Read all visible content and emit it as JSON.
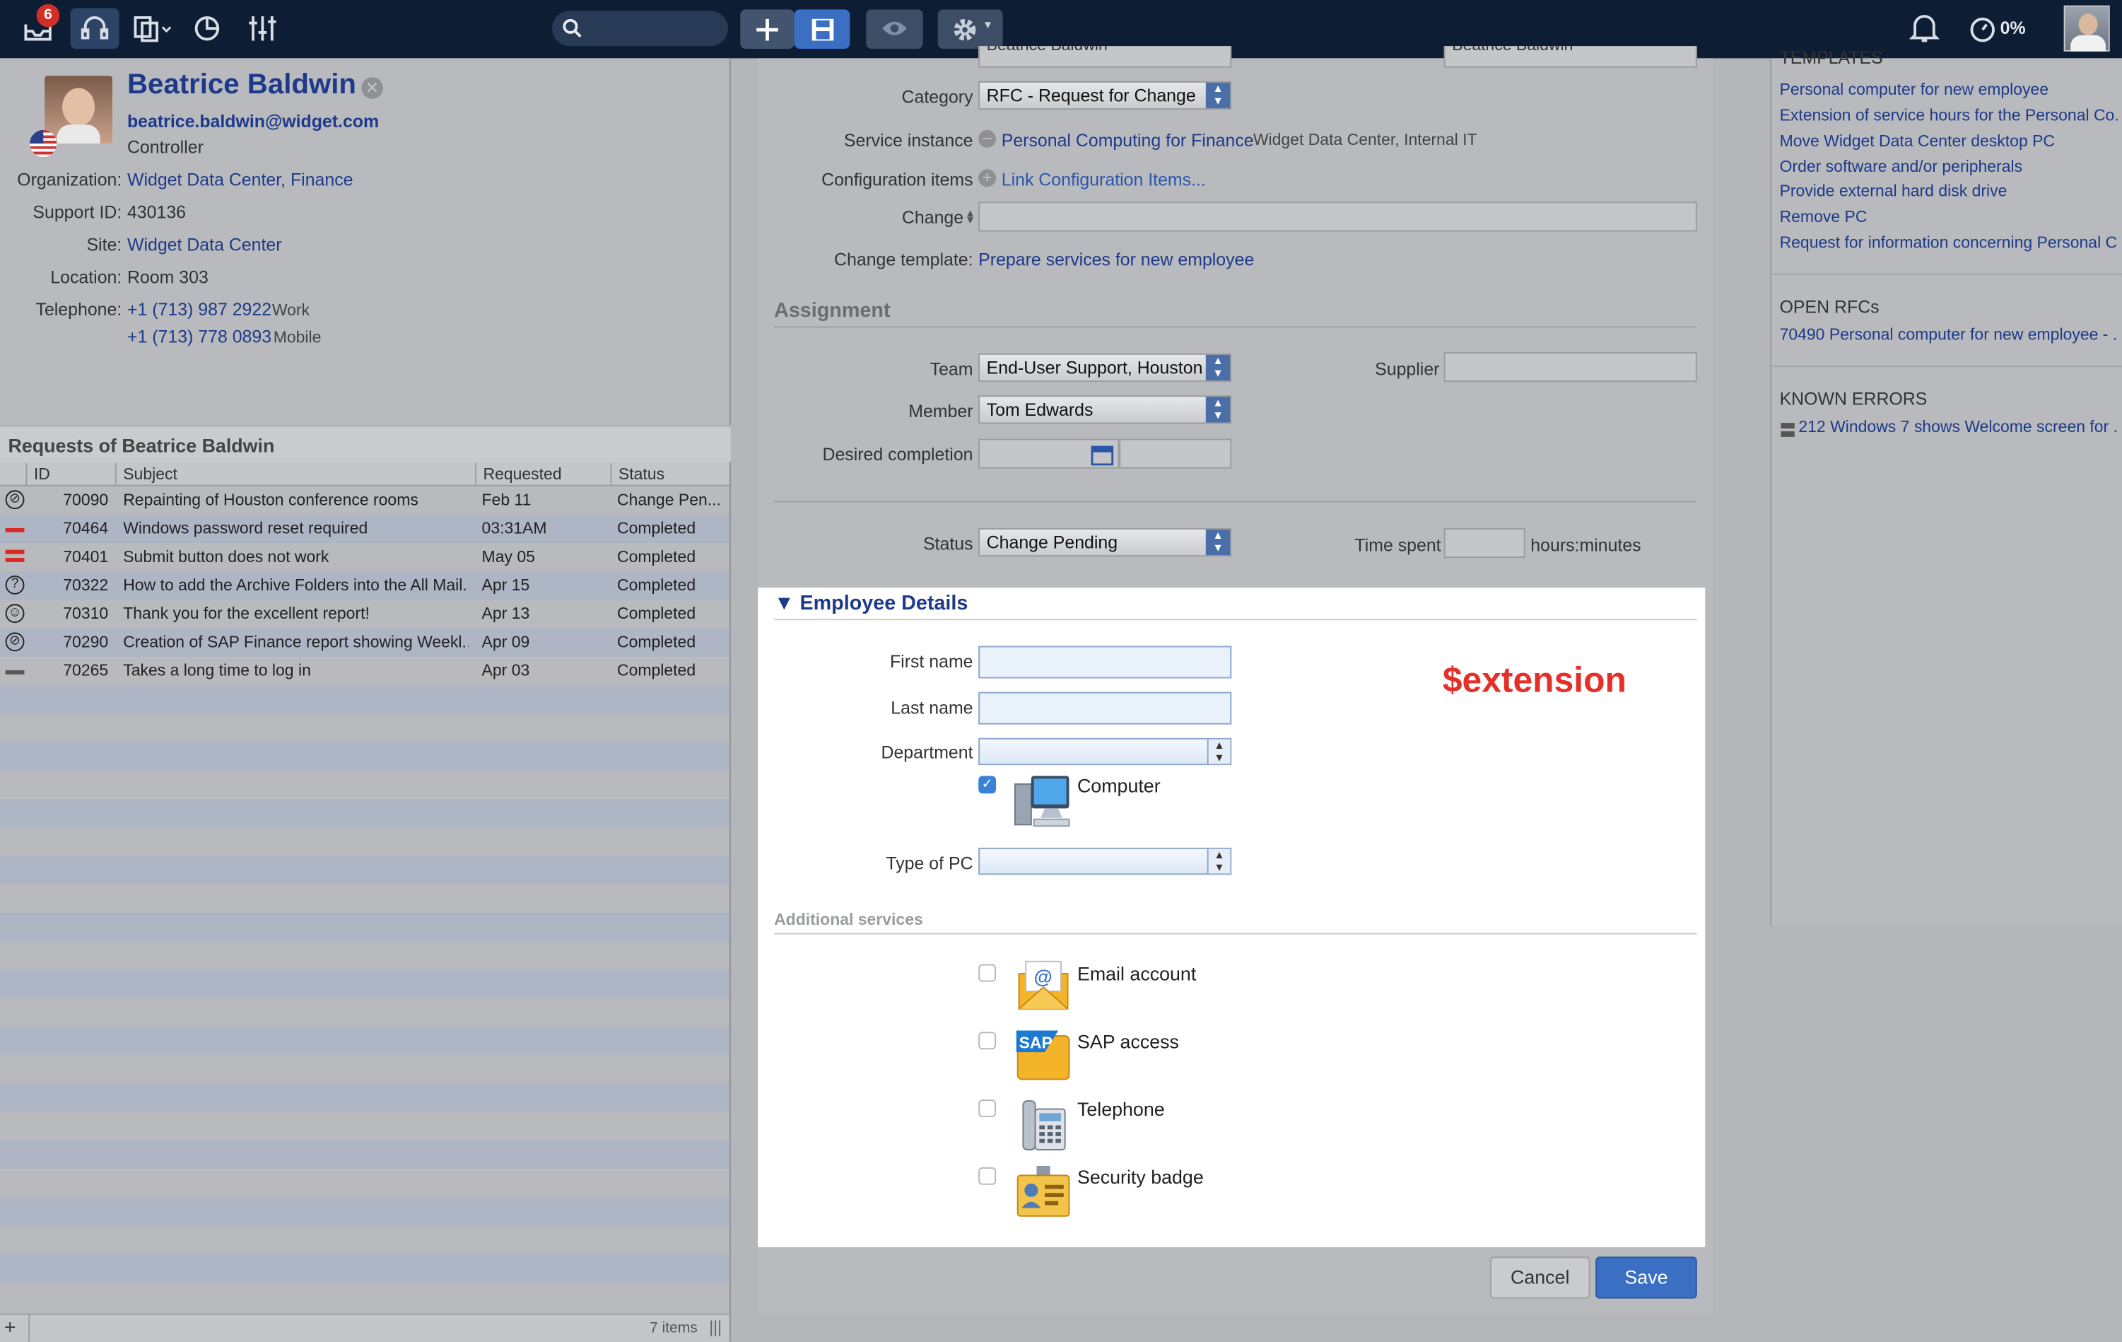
{
  "topbar": {
    "badge_count": "6",
    "percent": "0%",
    "icons": [
      "inbox-icon",
      "headset-icon",
      "copy-icon",
      "pie-chart-icon",
      "sliders-icon",
      "search-icon",
      "plus-icon",
      "save-icon",
      "eye-icon",
      "gear-icon",
      "bell-icon",
      "timer-icon",
      "user-avatar"
    ]
  },
  "person": {
    "name": "Beatrice Baldwin",
    "email": "beatrice.baldwin@widget.com",
    "title": "Controller",
    "org_label": "Organization:",
    "org": "Widget Data Center, Finance",
    "support_label": "Support ID:",
    "support_id": "430136",
    "site_label": "Site:",
    "site": "Widget Data Center",
    "location_label": "Location:",
    "location": "Room 303",
    "phone_label": "Telephone:",
    "phone1": "+1 (713) 987 2922",
    "phone1_type": "Work",
    "phone2": "+1 (713) 778 0893",
    "phone2_type": "Mobile"
  },
  "requests": {
    "title": "Requests of Beatrice Baldwin",
    "columns": [
      "ID",
      "Subject",
      "Requested",
      "Status"
    ],
    "rows": [
      {
        "id": "70090",
        "subject": "Repainting of Houston conference rooms",
        "requested": "Feb 11",
        "status": "Change Pen..."
      },
      {
        "id": "70464",
        "subject": "Windows password reset required",
        "requested": "03:31AM",
        "status": "Completed"
      },
      {
        "id": "70401",
        "subject": "Submit button does not work",
        "requested": "May 05",
        "status": "Completed"
      },
      {
        "id": "70322",
        "subject": "How to add the Archive Folders into the All Mail...",
        "requested": "Apr 15",
        "status": "Completed"
      },
      {
        "id": "70310",
        "subject": "Thank you for the excellent report!",
        "requested": "Apr 13",
        "status": "Completed"
      },
      {
        "id": "70290",
        "subject": "Creation of SAP Finance report showing Weekl...",
        "requested": "Apr 09",
        "status": "Completed"
      },
      {
        "id": "70265",
        "subject": "Takes a long time to log in",
        "requested": "Apr 03",
        "status": "Completed"
      }
    ],
    "footer": "7 items"
  },
  "form": {
    "top_partial_left": "Beatrice Baldwin",
    "top_partial_right": "Beatrice Baldwin",
    "category_label": "Category",
    "category": "RFC - Request for Change",
    "service_label": "Service instance",
    "service": "Personal Computing for Finance",
    "service_extra": "Widget Data Center, Internal IT",
    "config_label": "Configuration items",
    "config_link": "Link Configuration Items...",
    "change_label": "Change",
    "template_label": "Change template:",
    "template": "Prepare services for new employee",
    "assignment": "Assignment",
    "team_label": "Team",
    "team": "End-User Support, Houston",
    "supplier_label": "Supplier",
    "member_label": "Member",
    "member": "Tom Edwards",
    "desired_label": "Desired completion",
    "status_label": "Status",
    "status": "Change Pending",
    "time_label": "Time spent",
    "time_unit": "hours:minutes"
  },
  "employee": {
    "title": "▼ Employee Details",
    "extension": "$extension",
    "first_label": "First name",
    "last_label": "Last name",
    "dept_label": "Department",
    "computer": "Computer",
    "computer_checked": true,
    "pc_label": "Type of PC",
    "additional": "Additional services",
    "services": [
      "Email account",
      "SAP access",
      "Telephone",
      "Security badge"
    ],
    "sap_text": "SAP"
  },
  "buttons": {
    "cancel": "Cancel",
    "save": "Save"
  },
  "sidebar": {
    "templates_title": "TEMPLATES",
    "templates": [
      "Personal computer for new employee",
      "Extension of service hours for the Personal Co...",
      "Move Widget Data Center desktop PC",
      "Order software and/or peripherals",
      "Provide external hard disk drive",
      "Remove PC",
      "Request for information concerning Personal C..."
    ],
    "rfcs_title": "OPEN RFCs",
    "rfc": "70490  Personal computer for new employee - ...",
    "errors_title": "KNOWN ERRORS",
    "error": "212  Windows 7 shows Welcome screen for ..."
  },
  "colors": {
    "topbar": "#0d1d33",
    "accent": "#3a6fc4",
    "link": "#1d3a8a",
    "extension": "#e5302a"
  }
}
